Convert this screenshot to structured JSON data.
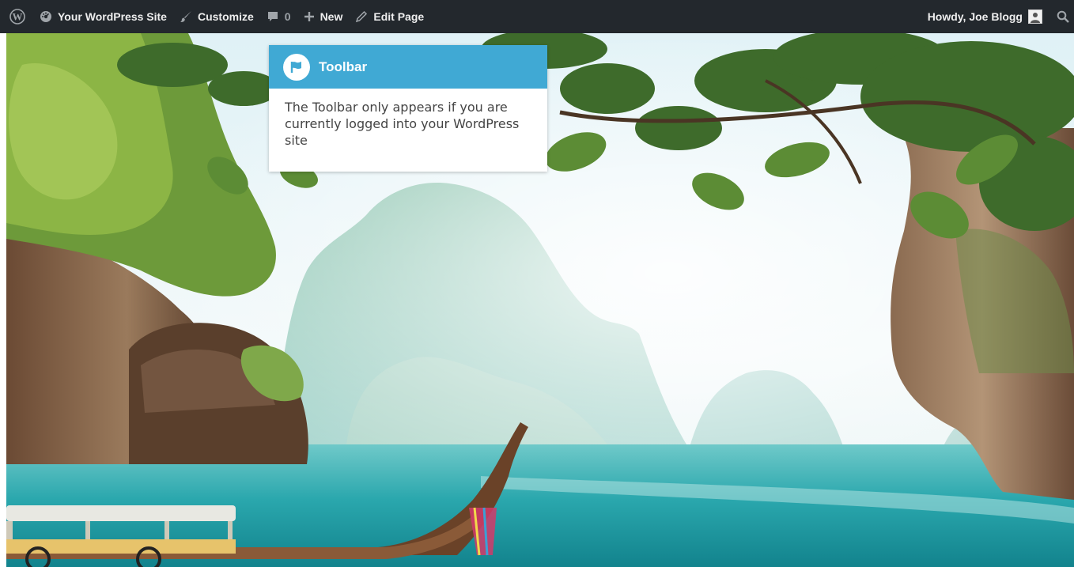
{
  "toolbar": {
    "logo_icon": "wordpress-logo-icon",
    "site_name": "Your WordPress Site",
    "customize": "Customize",
    "comments_count": "0",
    "new": "New",
    "edit_page": "Edit Page",
    "greeting": "Howdy, Joe Blogg",
    "background_color": "#23282d",
    "text_color": "#eeeeee"
  },
  "tooltip": {
    "title": "Toolbar",
    "icon": "flag-icon",
    "body": "The Toolbar only appears if you are currently logged into your WordPress site",
    "header_color": "#40a9d4"
  }
}
